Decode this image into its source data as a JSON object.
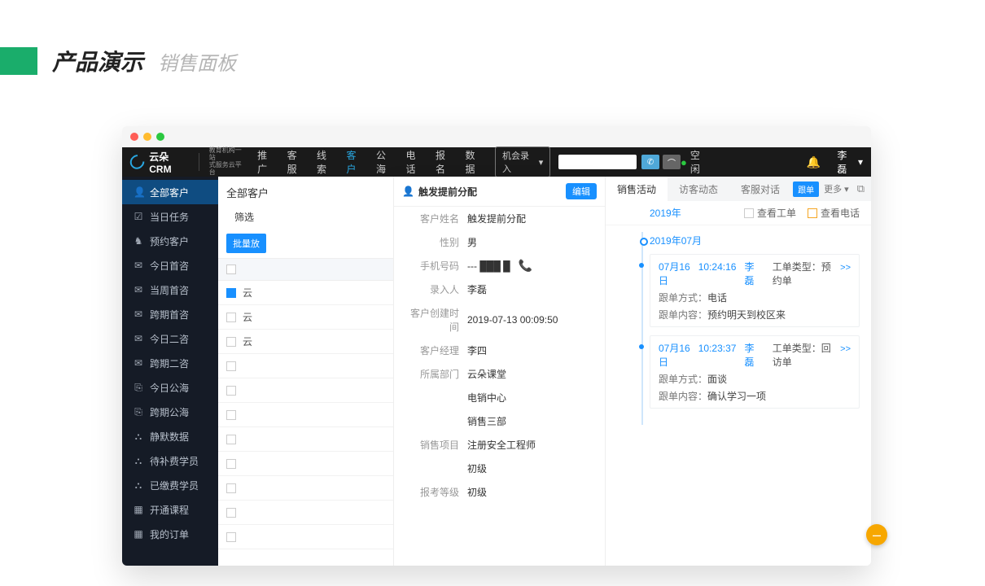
{
  "slide": {
    "title": "产品演示",
    "subtitle": "销售面板"
  },
  "logo": {
    "brand": "云朵CRM",
    "sub1": "教育机构一站",
    "sub2": "式服务云平台"
  },
  "nav": {
    "items": [
      "推广",
      "客服",
      "线索",
      "客户",
      "公海",
      "电话",
      "报名",
      "数据"
    ],
    "active_index": 3,
    "entry_button": "机会录入",
    "status_text": "空闲",
    "user": "李磊"
  },
  "sidebar": {
    "items": [
      {
        "icon": "👤",
        "label": "全部客户"
      },
      {
        "icon": "☑",
        "label": "当日任务"
      },
      {
        "icon": "♞",
        "label": "预约客户"
      },
      {
        "icon": "✉",
        "label": "今日首咨"
      },
      {
        "icon": "✉",
        "label": "当周首咨"
      },
      {
        "icon": "✉",
        "label": "跨期首咨"
      },
      {
        "icon": "✉",
        "label": "今日二咨"
      },
      {
        "icon": "✉",
        "label": "跨期二咨"
      },
      {
        "icon": "⎘",
        "label": "今日公海"
      },
      {
        "icon": "⎘",
        "label": "跨期公海"
      },
      {
        "icon": "⛬",
        "label": "静默数据"
      },
      {
        "icon": "⛬",
        "label": "待补费学员"
      },
      {
        "icon": "⛬",
        "label": "已缴费学员"
      },
      {
        "icon": "▦",
        "label": "开通课程"
      },
      {
        "icon": "▦",
        "label": "我的订单"
      }
    ],
    "active_index": 0
  },
  "table": {
    "title": "全部客户",
    "filter_label": "筛选",
    "bulk_button": "批量放",
    "rows": [
      "云",
      "云",
      "云"
    ]
  },
  "detail": {
    "header": "触发提前分配",
    "edit": "编辑",
    "fields": [
      {
        "label": "客户姓名",
        "value": "触发提前分配"
      },
      {
        "label": "性别",
        "value": "男"
      },
      {
        "label": "手机号码",
        "value": "--- ███ █",
        "phone": true
      },
      {
        "label": "录入人",
        "value": "李磊"
      },
      {
        "label": "客户创建时间",
        "value": "2019-07-13 00:09:50"
      },
      {
        "label": "客户经理",
        "value": "李四"
      },
      {
        "label": "所属部门",
        "value": "云朵课堂"
      },
      {
        "label": "",
        "value": "电销中心"
      },
      {
        "label": "",
        "value": "销售三部"
      },
      {
        "label": "销售项目",
        "value": "注册安全工程师"
      },
      {
        "label": "",
        "value": "初级"
      },
      {
        "label": "报考等级",
        "value": "初级"
      }
    ]
  },
  "timeline": {
    "tabs": [
      "销售活动",
      "访客动态",
      "客服对话"
    ],
    "active_tab": 0,
    "badge": "跟单",
    "more": "更多 ▾",
    "year": "2019年",
    "checkbox1": "查看工单",
    "checkbox2": "查看电话",
    "month": "2019年07月",
    "entries": [
      {
        "date": "07月16日",
        "time": "10:24:16",
        "user": "李磊",
        "type_label": "工单类型：",
        "type_value": "预约单",
        "method_label": "跟单方式：",
        "method_value": "电话",
        "content_label": "跟单内容：",
        "content_value": "预约明天到校区来",
        "more": ">>"
      },
      {
        "date": "07月16日",
        "time": "10:23:37",
        "user": "李磊",
        "type_label": "工单类型：",
        "type_value": "回访单",
        "method_label": "跟单方式：",
        "method_value": "面谈",
        "content_label": "跟单内容：",
        "content_value": "确认学习一项",
        "more": ">>"
      }
    ]
  }
}
